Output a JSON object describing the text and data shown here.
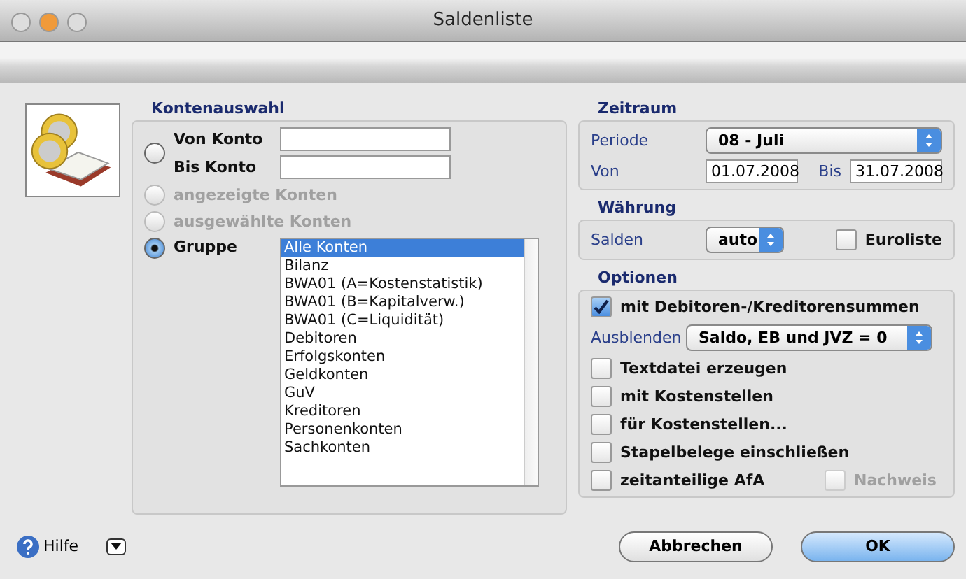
{
  "window": {
    "title": "Saldenliste"
  },
  "kontenauswahl": {
    "title": "Kontenauswahl",
    "options": [
      {
        "kind": "range",
        "selected": false,
        "disabled": false,
        "fields": [
          "Von Konto",
          "Bis Konto"
        ]
      },
      {
        "kind": "plain",
        "selected": false,
        "disabled": true,
        "label": "angezeigte Konten"
      },
      {
        "kind": "plain",
        "selected": false,
        "disabled": true,
        "label": "ausgewählte Konten"
      },
      {
        "kind": "group",
        "selected": true,
        "disabled": false,
        "label": "Gruppe",
        "items": [
          {
            "label": "Alle Konten",
            "selected": true
          },
          {
            "label": "Bilanz",
            "selected": false
          },
          {
            "label": "BWA01 (A=Kostenstatistik)",
            "selected": false
          },
          {
            "label": "BWA01 (B=Kapitalverw.)",
            "selected": false
          },
          {
            "label": "BWA01 (C=Liquidität)",
            "selected": false
          },
          {
            "label": "Debitoren",
            "selected": false
          },
          {
            "label": "Erfolgskonten",
            "selected": false
          },
          {
            "label": "Geldkonten",
            "selected": false
          },
          {
            "label": "GuV",
            "selected": false
          },
          {
            "label": "Kreditoren",
            "selected": false
          },
          {
            "label": "Personenkonten",
            "selected": false
          },
          {
            "label": "Sachkonten",
            "selected": false
          }
        ]
      }
    ]
  },
  "zeitraum": {
    "title": "Zeitraum",
    "periode_label": "Periode",
    "periode": "08 - Juli",
    "von_label": "Von",
    "von": "01.07.2008",
    "bis_label": "Bis",
    "bis": "31.07.2008"
  },
  "waehrung": {
    "title": "Währung",
    "salden_label": "Salden",
    "salden": "auto",
    "euroliste": {
      "label": "Euroliste",
      "checked": false
    }
  },
  "optionen": {
    "title": "Optionen",
    "rows": [
      {
        "kind": "checkbox",
        "label": "mit Debitoren-/Kreditorensummen",
        "checked": true,
        "disabled": false
      },
      {
        "kind": "select",
        "label": "Ausblenden",
        "value": "Saldo, EB und JVZ = 0"
      },
      {
        "kind": "checkbox",
        "label": "Textdatei erzeugen",
        "checked": false,
        "disabled": false
      },
      {
        "kind": "checkbox",
        "label": "mit Kostenstellen",
        "checked": false,
        "disabled": false
      },
      {
        "kind": "checkbox",
        "label": "für Kostenstellen...",
        "checked": false,
        "disabled": false
      },
      {
        "kind": "checkbox",
        "label": "Stapelbelege einschließen",
        "checked": false,
        "disabled": false
      },
      {
        "kind": "checkbox",
        "label": "zeitanteilige AfA",
        "checked": false,
        "disabled": false,
        "extra": {
          "label": "Nachweis",
          "checked": false,
          "disabled": true
        }
      }
    ]
  },
  "footer": {
    "help": "Hilfe",
    "buttons": [
      {
        "label": "Abbrechen",
        "default": false
      },
      {
        "label": "OK",
        "default": true
      }
    ]
  }
}
